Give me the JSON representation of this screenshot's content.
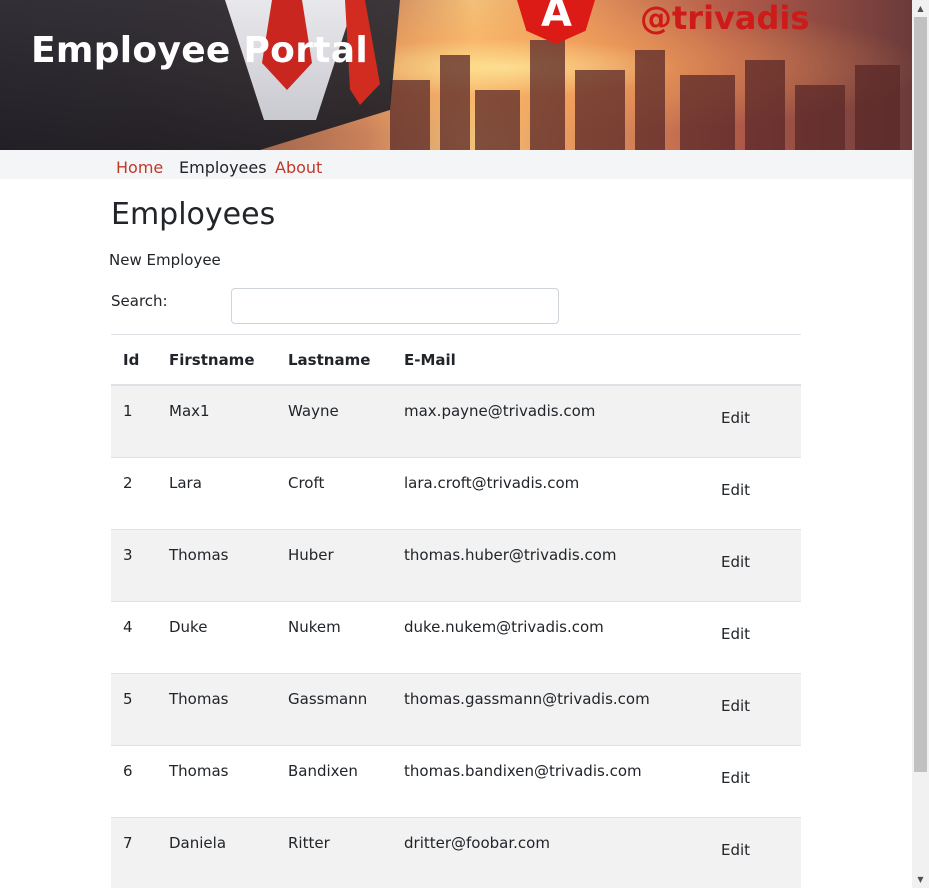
{
  "header": {
    "title": "Employee Portal",
    "brand_text": "@trivadis",
    "logo_letter": "A",
    "accent_color": "#cf1a1a"
  },
  "nav": {
    "items": [
      {
        "label": "Home",
        "active": false
      },
      {
        "label": "Employees",
        "active": true
      },
      {
        "label": "About",
        "active": false
      }
    ]
  },
  "main": {
    "heading": "Employees",
    "new_link": "New Employee",
    "search": {
      "label": "Search:",
      "value": "",
      "placeholder": ""
    }
  },
  "table": {
    "columns": [
      "Id",
      "Firstname",
      "Lastname",
      "E-Mail",
      ""
    ],
    "edit_label": "Edit",
    "rows": [
      {
        "id": "1",
        "firstname": "Max1",
        "lastname": "Wayne",
        "email": "max.payne@trivadis.com"
      },
      {
        "id": "2",
        "firstname": "Lara",
        "lastname": "Croft",
        "email": "lara.croft@trivadis.com"
      },
      {
        "id": "3",
        "firstname": "Thomas",
        "lastname": "Huber",
        "email": "thomas.huber@trivadis.com"
      },
      {
        "id": "4",
        "firstname": "Duke",
        "lastname": "Nukem",
        "email": "duke.nukem@trivadis.com"
      },
      {
        "id": "5",
        "firstname": "Thomas",
        "lastname": "Gassmann",
        "email": "thomas.gassmann@trivadis.com"
      },
      {
        "id": "6",
        "firstname": "Thomas",
        "lastname": "Bandixen",
        "email": "thomas.bandixen@trivadis.com"
      },
      {
        "id": "7",
        "firstname": "Daniela",
        "lastname": "Ritter",
        "email": "dritter@foobar.com"
      }
    ]
  }
}
